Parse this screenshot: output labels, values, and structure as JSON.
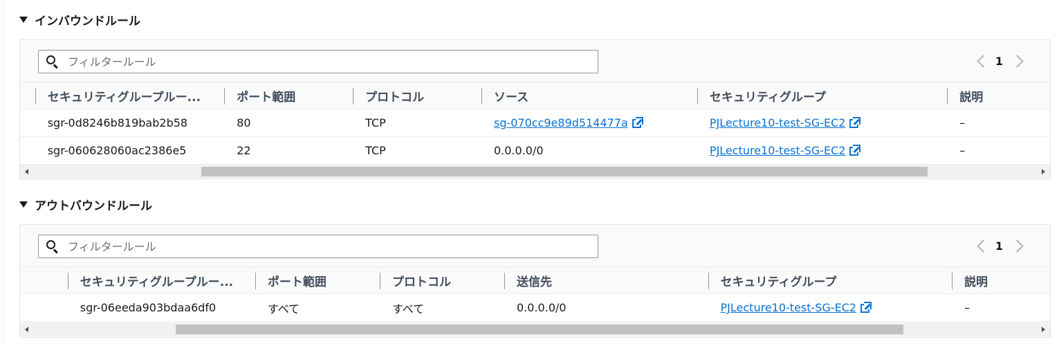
{
  "colors": {
    "link": "#0972d3",
    "header_text": "#414d5c",
    "border": "#eaeded"
  },
  "inbound": {
    "title": "インバウンドルール",
    "filter_placeholder": "フィルタールール",
    "page": "1",
    "columns": [
      "セキュリティグループルー...",
      "ポート範囲",
      "プロトコル",
      "ソース",
      "セキュリティグループ",
      "説明"
    ],
    "rows": [
      {
        "rule_id": "sgr-0d8246b819bab2b58",
        "port": "80",
        "protocol": "TCP",
        "source": "sg-070cc9e89d514477a",
        "security_group": "PJLecture10-test-SG-EC2",
        "description": "–"
      },
      {
        "rule_id": "sgr-060628060ac2386e5",
        "port": "22",
        "protocol": "TCP",
        "source": "0.0.0.0/0",
        "security_group": "PJLecture10-test-SG-EC2",
        "description": "–"
      }
    ]
  },
  "outbound": {
    "title": "アウトバウンドルール",
    "filter_placeholder": "フィルタールール",
    "page": "1",
    "columns": [
      "セキュリティグループルー...",
      "ポート範囲",
      "プロトコル",
      "送信先",
      "セキュリティグループ",
      "説明"
    ],
    "rows": [
      {
        "rule_id": "sgr-06eeda903bdaa6df0",
        "port": "すべて",
        "protocol": "すべて",
        "destination": "0.0.0.0/0",
        "security_group": "PJLecture10-test-SG-EC2",
        "description": "–"
      }
    ]
  }
}
